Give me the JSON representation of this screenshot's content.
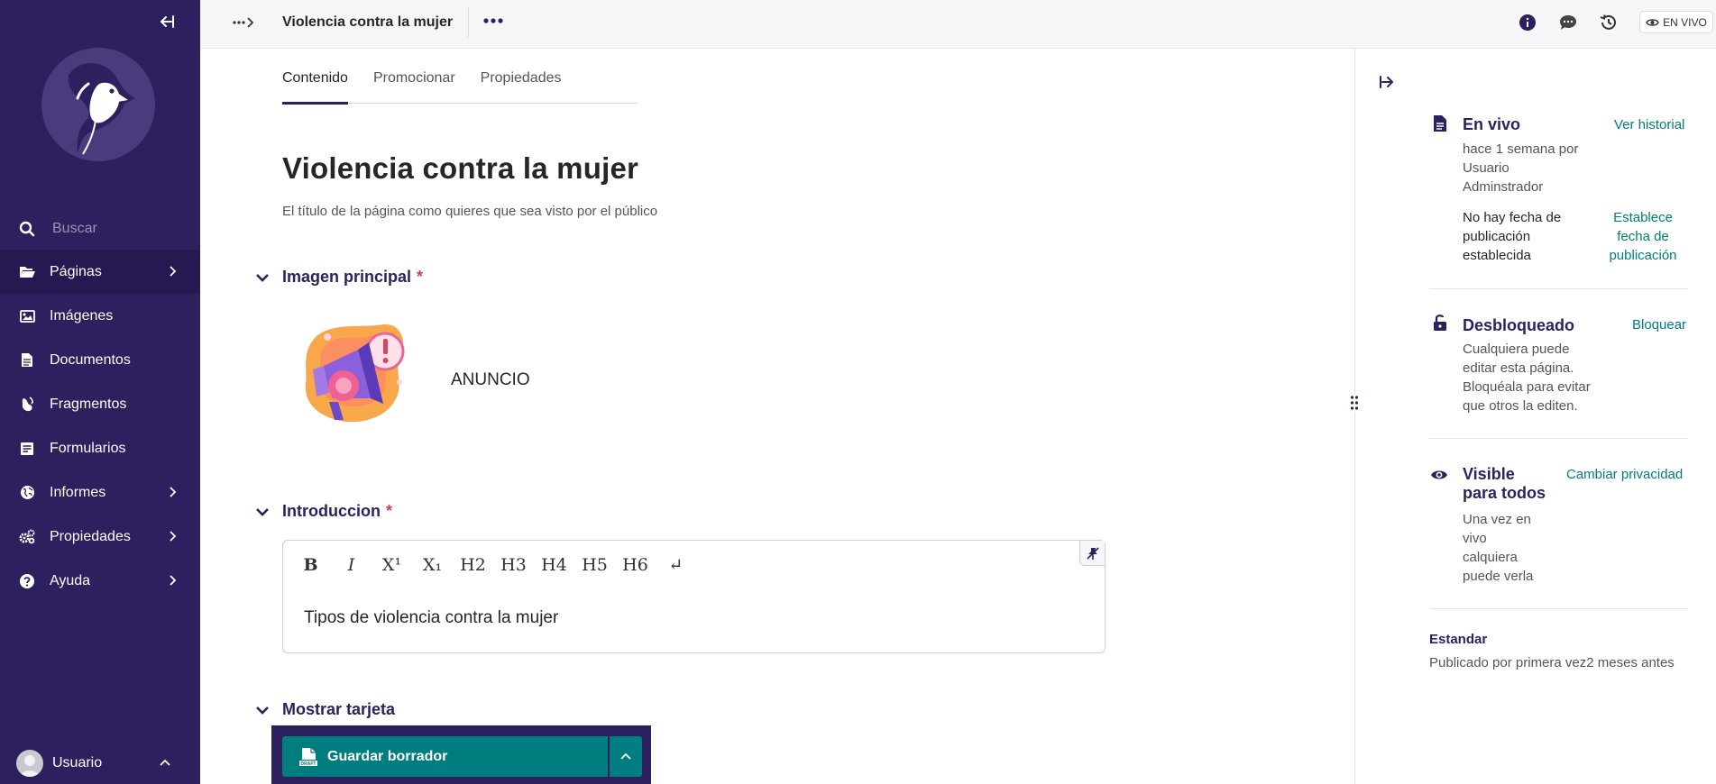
{
  "sidebar": {
    "search_placeholder": "Buscar",
    "items": [
      {
        "label": "Páginas",
        "icon": "folder-open-icon",
        "has_submenu": true,
        "active": true
      },
      {
        "label": "Imágenes",
        "icon": "image-icon",
        "has_submenu": false
      },
      {
        "label": "Documentos",
        "icon": "document-icon",
        "has_submenu": false
      },
      {
        "label": "Fragmentos",
        "icon": "snippet-icon",
        "has_submenu": false
      },
      {
        "label": "Formularios",
        "icon": "form-icon",
        "has_submenu": false
      },
      {
        "label": "Informes",
        "icon": "globe-icon",
        "has_submenu": true
      },
      {
        "label": "Propiedades",
        "icon": "cogs-icon",
        "has_submenu": true
      },
      {
        "label": "Ayuda",
        "icon": "help-icon",
        "has_submenu": true
      }
    ],
    "user_label": "Usuario"
  },
  "header": {
    "title": "Violencia contra la mujer",
    "live_badge": "EN VIVO"
  },
  "tabs": [
    {
      "label": "Contenido",
      "active": true
    },
    {
      "label": "Promocionar",
      "active": false
    },
    {
      "label": "Propiedades",
      "active": false
    }
  ],
  "main": {
    "page_title": "Violencia contra la mujer",
    "page_title_help": "El título de la página como quieres que sea visto por el público",
    "sections": {
      "image": {
        "label": "Imagen principal",
        "required": "*",
        "image_title": "ANUNCIO"
      },
      "intro": {
        "label": "Introduccion",
        "required": "*",
        "content": "Tipos de violencia contra la mujer"
      },
      "card": {
        "label": "Mostrar tarjeta"
      }
    },
    "toolbar": [
      "B",
      "I",
      "X¹",
      "X₁",
      "H2",
      "H3",
      "H4",
      "H5",
      "H6",
      "↵"
    ]
  },
  "footer": {
    "save_label": "Guardar borrador",
    "draft_icon_text": "DRAFT"
  },
  "status_panel": {
    "live": {
      "title": "En vivo",
      "detail_lines": [
        "hace 1 semana por",
        "Usuario",
        "Adminstrador"
      ],
      "link": "Ver historial",
      "schedule_lines": [
        "No hay fecha de",
        "publicación",
        "establecida"
      ],
      "schedule_link_lines": [
        "Establece",
        "fecha de",
        "publicación"
      ]
    },
    "lock": {
      "title": "Desbloqueado",
      "link": "Bloquear",
      "detail_lines": [
        "Cualquiera puede",
        "editar esta página.",
        "Bloquéala para evitar",
        "que otros la editen."
      ]
    },
    "privacy": {
      "title_lines": [
        "Visible",
        "para todos"
      ],
      "link": "Cambiar privacidad",
      "detail_lines": [
        "Una vez en",
        "vivo",
        "calquiera",
        "puede verla"
      ]
    },
    "locale": {
      "title": "Estandar",
      "detail": "Publicado por primera vez2 meses antes"
    }
  },
  "colors": {
    "sidebar_bg": "#2e1f5e",
    "accent_teal": "#007d7e",
    "required_red": "#cd4444"
  }
}
